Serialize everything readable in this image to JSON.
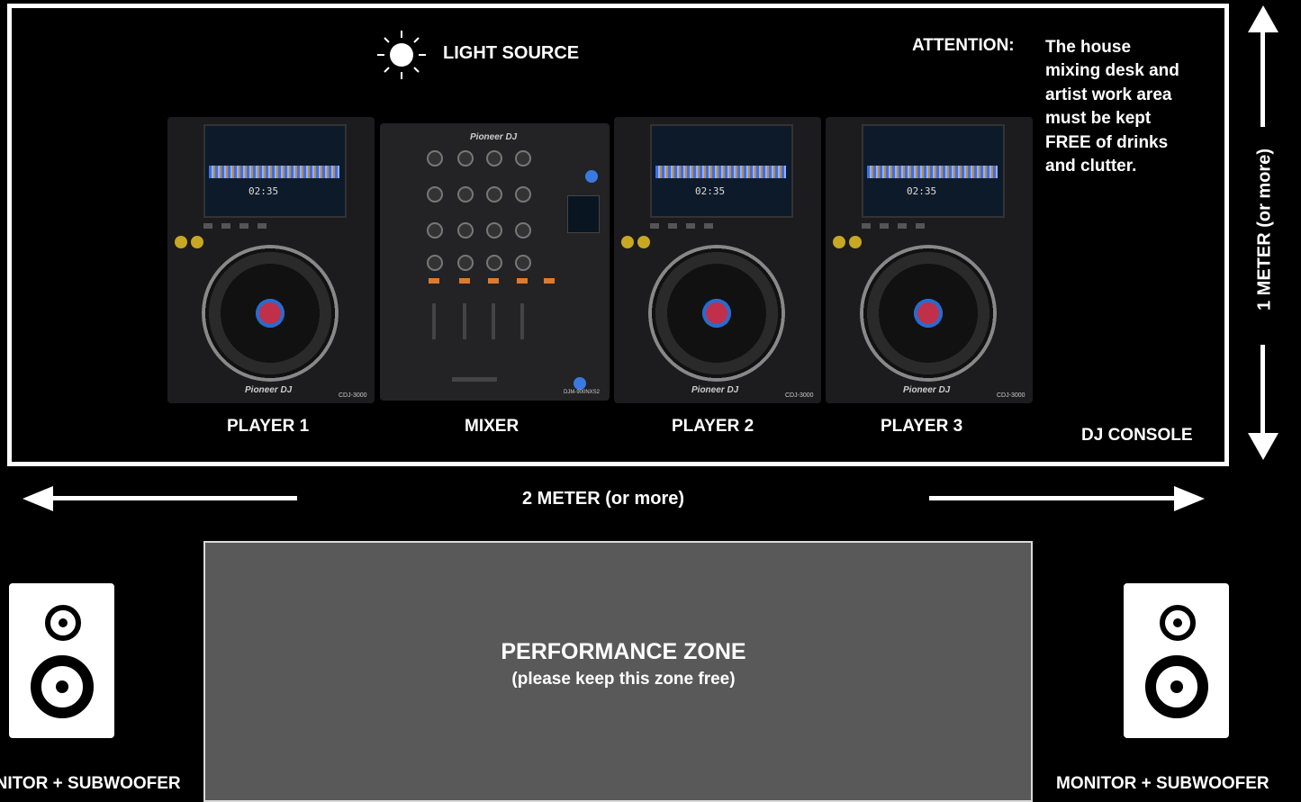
{
  "light_source": {
    "label": "LIGHT SOURCE",
    "icon": "sun-icon"
  },
  "attention": {
    "heading": "ATTENTION:",
    "lines": [
      "The house",
      "mixing desk and",
      "artist work area",
      "must be kept",
      "FREE of drinks",
      "and clutter."
    ]
  },
  "console": {
    "label": "DJ CONSOLE",
    "devices": [
      {
        "label": "PLAYER 1",
        "brand": "Pioneer DJ",
        "time": "02:35",
        "model": "CDJ-3000"
      },
      {
        "label": "MIXER",
        "brand": "Pioneer DJ",
        "model": "DJM-900NXS2"
      },
      {
        "label": "PLAYER 2",
        "brand": "Pioneer DJ",
        "time": "02:35",
        "model": "CDJ-3000"
      },
      {
        "label": "PLAYER 3",
        "brand": "Pioneer DJ",
        "time": "02:35",
        "model": "CDJ-3000"
      }
    ]
  },
  "dimensions": {
    "vertical": "1 METER (or more)",
    "horizontal": "2 METER (or more)"
  },
  "performance_zone": {
    "title": "PERFORMANCE ZONE",
    "subtitle": "(please keep this zone free)"
  },
  "monitors": {
    "left": "MONITOR + SUBWOOFER",
    "right": "MONITOR + SUBWOOFER"
  }
}
